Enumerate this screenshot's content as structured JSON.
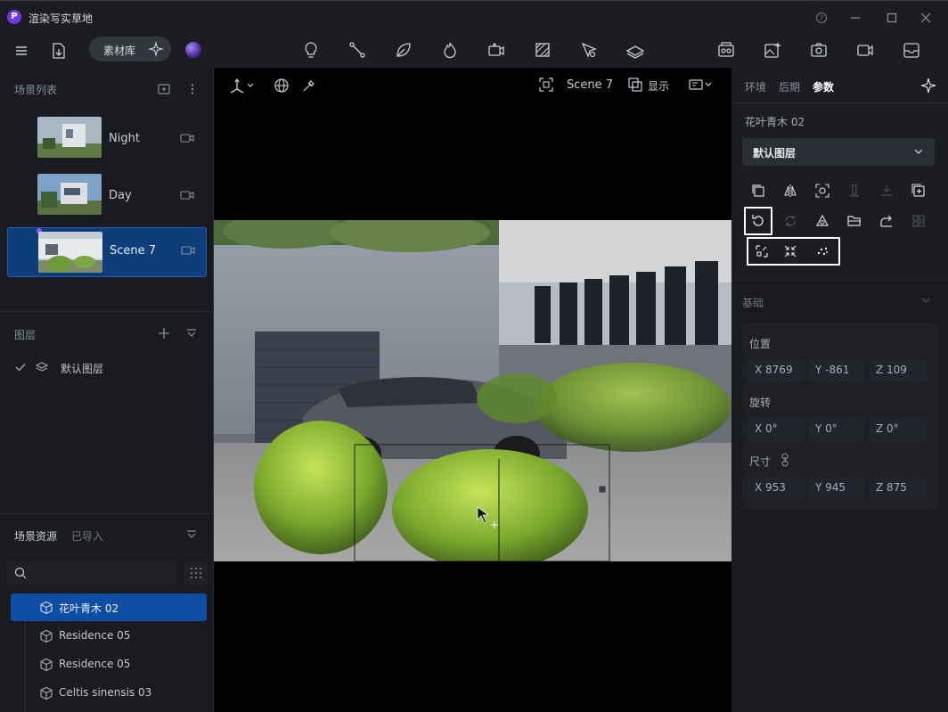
{
  "window": {
    "title": "渲染写实草地",
    "logo_letter": "P"
  },
  "toolbar": {
    "library_label": "素材库"
  },
  "scene_list": {
    "title": "场景列表",
    "scenes": [
      {
        "name": "Night",
        "selected": false
      },
      {
        "name": "Day",
        "selected": false
      },
      {
        "name": "Scene 7",
        "selected": true
      }
    ]
  },
  "layers": {
    "title": "图层",
    "items": [
      {
        "name": "默认图层",
        "checked": true
      }
    ]
  },
  "assets": {
    "title": "场景资源",
    "imported_tab": "已导入",
    "search_placeholder": "",
    "items": [
      {
        "name": "花叶青木 02",
        "selected": true
      },
      {
        "name": "Residence 05",
        "selected": false
      },
      {
        "name": "Residence 05",
        "selected": false
      },
      {
        "name": "Celtis sinensis 03",
        "selected": false
      }
    ]
  },
  "viewport": {
    "scene_label": "Scene 7",
    "display_label": "显示"
  },
  "properties": {
    "tabs": [
      "环境",
      "后期",
      "参数"
    ],
    "active_tab": "参数",
    "object_name": "花叶青木 02",
    "layer_select": "默认图层",
    "section_basic": "基础",
    "position": {
      "label": "位置",
      "x": "X 8769",
      "y": "Y -861",
      "z": "Z 109"
    },
    "rotation": {
      "label": "旋转",
      "x": "X 0°",
      "y": "Y 0°",
      "z": "Z 0°"
    },
    "size": {
      "label": "尺寸",
      "x": "X 953",
      "y": "Y 945",
      "z": "Z 875"
    }
  },
  "colors": {
    "accent": "#0d4da3",
    "highlight_box": "#ffffff",
    "logo": "#6d3be0"
  }
}
